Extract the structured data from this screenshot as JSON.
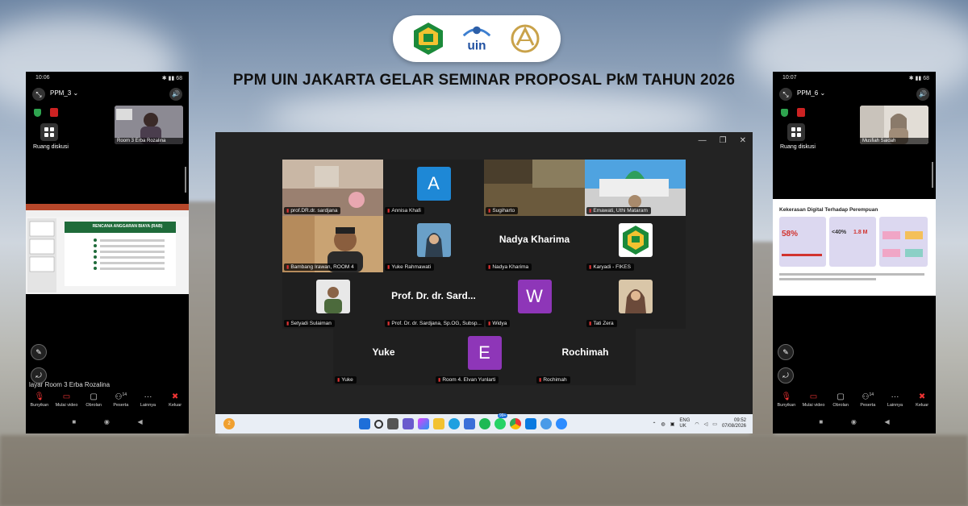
{
  "headline": "PPM UIN JAKARTA GELAR SEMINAR PROPOSAL PkM TAHUN 2026",
  "logos": [
    "kemenag-logo",
    "uin-logo",
    "ppm-logo"
  ],
  "uin_logo_text": "uin",
  "left_phone": {
    "time": "10:06",
    "battery": "68",
    "room": "PPM_3",
    "diskusi_label": "Ruang diskusi",
    "thumb_name": "Room 3 Erba Rozalina",
    "caption": "layar Room 3 Erba Rozalina",
    "share_title": "RENCANA ANGGARAN BIAYA (RAB)"
  },
  "right_phone": {
    "time": "10:07",
    "battery": "68",
    "room": "PPM_6",
    "diskusi_label": "Ruang diskusi",
    "thumb_name": "Musfiah Saidah",
    "share_title": "Kekerasan Digital Terhadap Perempuan",
    "stat1": "58%",
    "stat2": "<40%",
    "stat3": "1.8 M"
  },
  "controls": [
    {
      "label": "Bunyikan",
      "icon": "mic-off-icon"
    },
    {
      "label": "Mulai video",
      "icon": "video-off-icon"
    },
    {
      "label": "Obrolan",
      "icon": "chat-icon"
    },
    {
      "label": "Peserta",
      "icon": "people-icon",
      "badge": "14"
    },
    {
      "label": "Lainnya",
      "icon": "more-icon"
    },
    {
      "label": "Keluar",
      "icon": "leave-icon"
    }
  ],
  "meeting": {
    "participants": [
      {
        "name": "prof.DR.dr. sardjana",
        "type": "video"
      },
      {
        "name": "Annisa Khafi",
        "type": "avatar",
        "letter": "A",
        "color": "#1e88d6"
      },
      {
        "name": "Sugiharto",
        "type": "video"
      },
      {
        "name": "Emawati, Uthi Mataram",
        "type": "video"
      },
      {
        "name": "Bambang Irawan, ROOM 4",
        "type": "video"
      },
      {
        "name": "Yuke Rahmawati",
        "type": "photo"
      },
      {
        "name": "Nadya Kharima",
        "type": "name",
        "display": "Nadya Kharima"
      },
      {
        "name": "Karyadi - FIKES",
        "type": "logo"
      },
      {
        "name": "Setyadi Sulaiman",
        "type": "photo"
      },
      {
        "name": "Prof. Dr. dr. Sardjana, Sp.OG, Subsp...",
        "type": "name",
        "display": "Prof. Dr. dr. Sard..."
      },
      {
        "name": "Widya",
        "type": "avatar",
        "letter": "W",
        "color": "#8e36b8"
      },
      {
        "name": "Tati Zera",
        "type": "photo"
      },
      {
        "name": "Yuke",
        "type": "name",
        "display": "Yuke"
      },
      {
        "name": "Room 4. Elvan Yunlarti",
        "type": "avatar",
        "letter": "E",
        "color": "#8e36b8"
      },
      {
        "name": "Rochimah",
        "type": "name",
        "display": "Rochimah"
      }
    ],
    "taskbar": {
      "notif_badge": "2",
      "lang": "ENG",
      "region": "UK",
      "time": "09:52",
      "date": "07/08/2026",
      "app_badge": "99+"
    }
  }
}
